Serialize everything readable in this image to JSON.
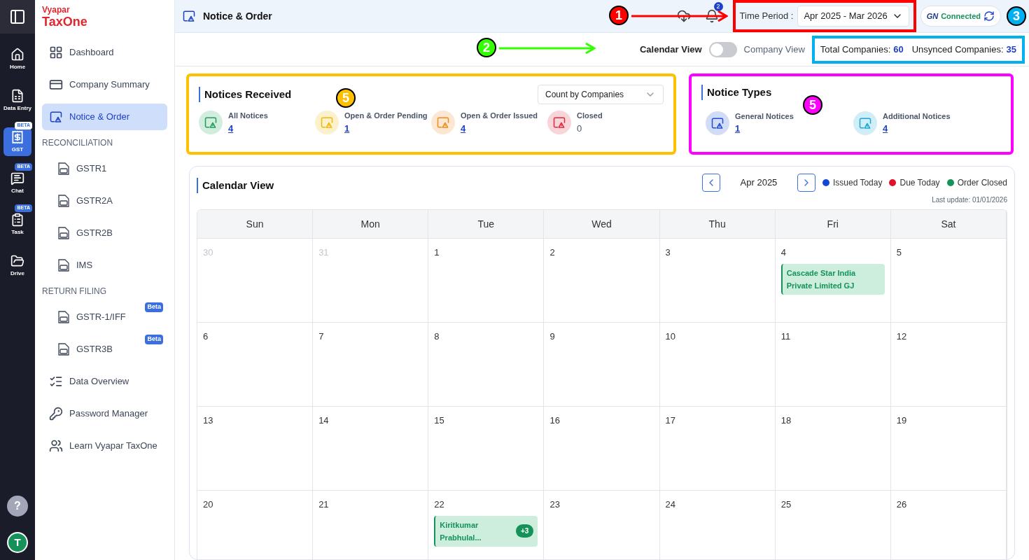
{
  "rail": {
    "items": [
      {
        "label": "Home",
        "selected": false
      },
      {
        "label": "Data Entry",
        "selected": false
      },
      {
        "label": "GST",
        "selected": true,
        "badge": "BETA"
      },
      {
        "label": "Chat",
        "selected": false,
        "badge": "BETA"
      },
      {
        "label": "Task",
        "selected": false,
        "badge": "BETA"
      },
      {
        "label": "Drive",
        "selected": false
      }
    ],
    "help": "?",
    "avatar": "T"
  },
  "sidebar": {
    "brand_top": "Vyapar",
    "brand_bottom": "TaxOne",
    "items": [
      {
        "kind": "item",
        "label": "Dashboard",
        "selected": false
      },
      {
        "kind": "item",
        "label": "Company Summary",
        "selected": false
      },
      {
        "kind": "item",
        "label": "Notice & Order",
        "selected": true
      },
      {
        "kind": "section",
        "label": "RECONCILIATION"
      },
      {
        "kind": "subitem",
        "label": "GSTR1",
        "selected": false
      },
      {
        "kind": "subitem",
        "label": "GSTR2A",
        "selected": false
      },
      {
        "kind": "subitem",
        "label": "GSTR2B",
        "selected": false
      },
      {
        "kind": "subitem",
        "label": "IMS",
        "selected": false
      },
      {
        "kind": "section",
        "label": "RETURN FILING"
      },
      {
        "kind": "subitem",
        "label": "GSTR-1/IFF",
        "selected": false,
        "badge": "Beta"
      },
      {
        "kind": "subitem",
        "label": "GSTR3B",
        "selected": false,
        "badge": "Beta"
      },
      {
        "kind": "item",
        "label": "Data Overview",
        "selected": false
      },
      {
        "kind": "item",
        "label": "Password Manager",
        "selected": false
      },
      {
        "kind": "item",
        "label": "Learn Vyapar TaxOne",
        "selected": false
      }
    ]
  },
  "header": {
    "title": "Notice & Order",
    "notification_count": "2",
    "time_period_label": "Time Period :",
    "time_period": "Apr 2025 - Mar 2026",
    "connection_logo": "GN",
    "connection": "Connected"
  },
  "toolbar": {
    "left_label": "Calendar View",
    "right_label": "Company View",
    "on": false,
    "total_label": "Total Companies:",
    "total": "60",
    "unsynced_label": "Unsynced Companies:",
    "unsynced": "35"
  },
  "notices_received": {
    "title": "Notices Received",
    "dropdown": "Count by Companies",
    "stats": [
      {
        "label": "All Notices",
        "value": "4",
        "color": "#1e9e5a",
        "linked": true
      },
      {
        "label": "Open & Order Pending",
        "value": "1",
        "color": "#f2b705",
        "linked": true
      },
      {
        "label": "Open & Order Issued",
        "value": "4",
        "color": "#f08a1c",
        "linked": true
      },
      {
        "label": "Closed",
        "value": "0",
        "color": "#e0283a",
        "linked": false
      }
    ]
  },
  "notice_types": {
    "title": "Notice Types",
    "stats": [
      {
        "label": "General Notices",
        "value": "1",
        "color": "#1d4ed8",
        "linked": true
      },
      {
        "label": "Additional Notices",
        "value": "4",
        "color": "#1aa7d8",
        "linked": true
      }
    ]
  },
  "calendar": {
    "title": "Calendar View",
    "month": "Apr 2025",
    "legend": [
      {
        "label": "Issued Today",
        "color": "#1447d6"
      },
      {
        "label": "Due Today",
        "color": "#e0112b"
      },
      {
        "label": "Order Closed",
        "color": "#15925a"
      }
    ],
    "last_update": "Last update: 01/01/2026",
    "weekdays": [
      "Sun",
      "Mon",
      "Tue",
      "Wed",
      "Thu",
      "Fri",
      "Sat"
    ],
    "weeks": [
      [
        {
          "day": "30",
          "in_month": false
        },
        {
          "day": "31",
          "in_month": false
        },
        {
          "day": "1",
          "in_month": true
        },
        {
          "day": "2",
          "in_month": true
        },
        {
          "day": "3",
          "in_month": true
        },
        {
          "day": "4",
          "in_month": true,
          "events": [
            {
              "title": "Cascade Star India Private Limited GJ"
            }
          ]
        },
        {
          "day": "5",
          "in_month": true
        }
      ],
      [
        {
          "day": "6",
          "in_month": true
        },
        {
          "day": "7",
          "in_month": true
        },
        {
          "day": "8",
          "in_month": true
        },
        {
          "day": "9",
          "in_month": true
        },
        {
          "day": "10",
          "in_month": true
        },
        {
          "day": "11",
          "in_month": true
        },
        {
          "day": "12",
          "in_month": true
        }
      ],
      [
        {
          "day": "13",
          "in_month": true
        },
        {
          "day": "14",
          "in_month": true
        },
        {
          "day": "15",
          "in_month": true
        },
        {
          "day": "16",
          "in_month": true
        },
        {
          "day": "17",
          "in_month": true
        },
        {
          "day": "18",
          "in_month": true
        },
        {
          "day": "19",
          "in_month": true
        }
      ],
      [
        {
          "day": "20",
          "in_month": true
        },
        {
          "day": "21",
          "in_month": true
        },
        {
          "day": "22",
          "in_month": true,
          "events": [
            {
              "title": "Kiritkumar Prabhulal...",
              "more": "+3"
            }
          ]
        },
        {
          "day": "23",
          "in_month": true
        },
        {
          "day": "24",
          "in_month": true
        },
        {
          "day": "25",
          "in_month": true
        },
        {
          "day": "26",
          "in_month": true
        }
      ]
    ]
  },
  "annotations": [
    {
      "number": "1",
      "color": "#ff0000"
    },
    {
      "number": "2",
      "color": "#33ff00"
    },
    {
      "number": "3",
      "color": "#00b0f0"
    },
    {
      "number": "5",
      "color": "#ffc000"
    },
    {
      "number": "5",
      "color": "#ff00ff"
    }
  ]
}
